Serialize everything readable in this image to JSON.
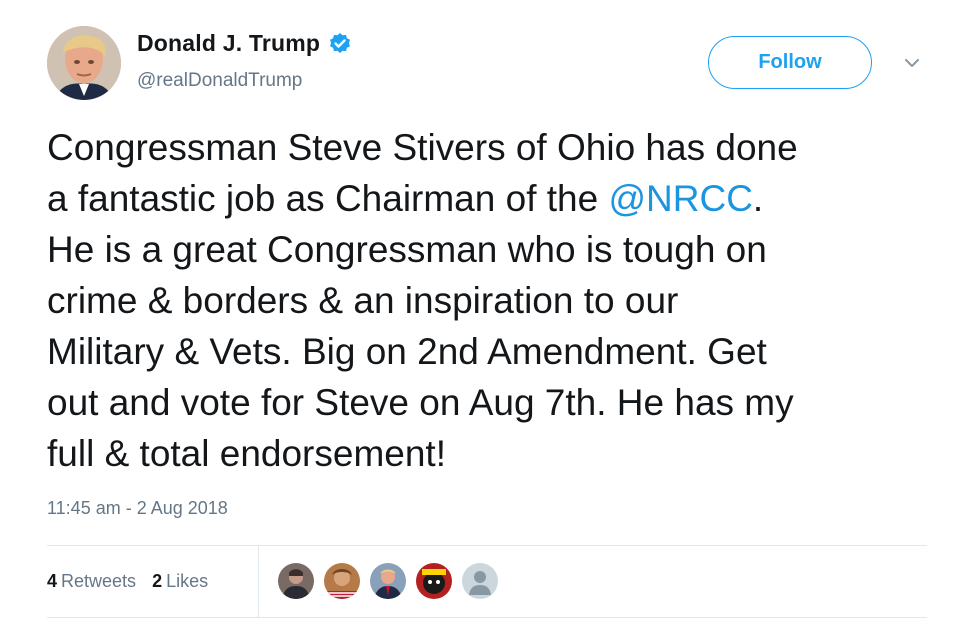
{
  "author": {
    "display_name": "Donald J. Trump",
    "handle": "@realDonaldTrump",
    "verified": true,
    "avatar_icon": "profile-photo-icon"
  },
  "header": {
    "follow_label": "Follow",
    "menu_icon": "chevron-down-icon"
  },
  "tweet": {
    "text_before_mention": "Congressman Steve Stivers of Ohio has done\na fantastic job as Chairman of the ",
    "mention": "@NRCC",
    "text_after_mention": ".\nHe is a great Congressman who is tough on\ncrime & borders & an inspiration to our\nMilitary & Vets. Big on 2nd Amendment. Get\nout and vote for Steve on Aug 7th. He has my\nfull & total endorsement!",
    "timestamp": "11:45 am - 2 Aug 2018"
  },
  "stats": {
    "retweets_count": "4",
    "retweets_label": "Retweets",
    "likes_count": "2",
    "likes_label": "Likes"
  },
  "likers": [
    {
      "icon": "liker-avatar-icon"
    },
    {
      "icon": "liker-avatar-icon"
    },
    {
      "icon": "liker-avatar-icon"
    },
    {
      "icon": "liker-avatar-icon"
    },
    {
      "icon": "default-avatar-icon"
    }
  ],
  "colors": {
    "accent": "#1da1f2",
    "mention": "#1b95e0",
    "secondary_text": "#657786",
    "primary_text": "#14171a",
    "divider": "#e1e8ed"
  }
}
